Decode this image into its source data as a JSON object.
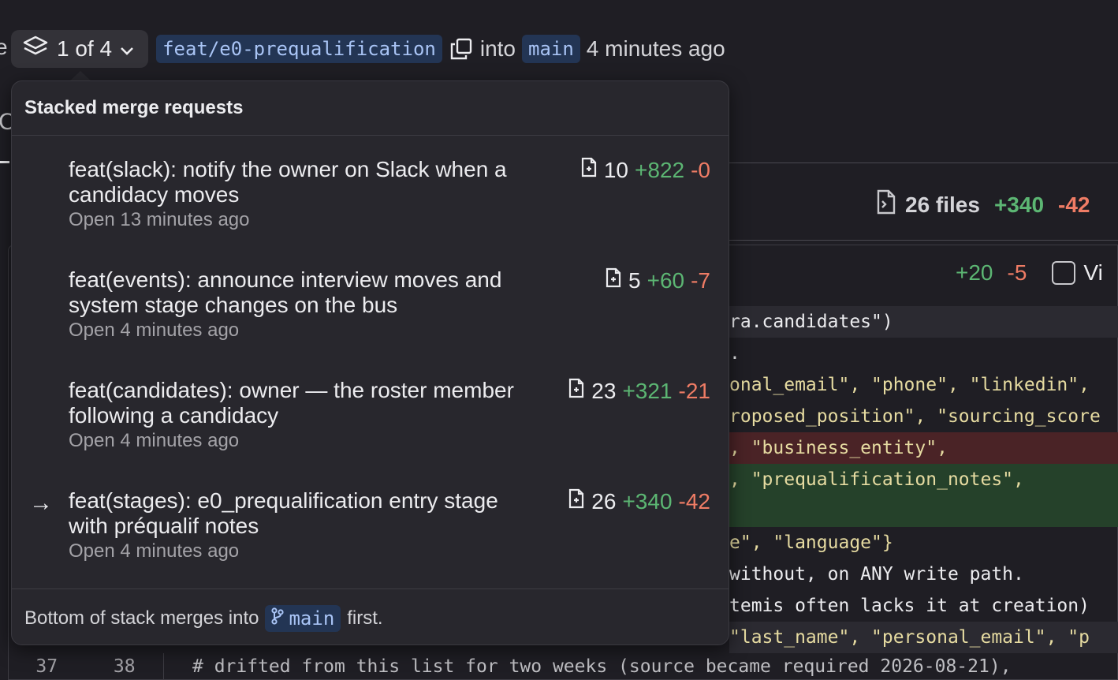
{
  "header": {
    "stack_label": "1 of 4",
    "source_branch": "feat/e0-prequalification",
    "into_text": "into",
    "target_branch": "main",
    "time": "4 minutes ago"
  },
  "background": {
    "edge_char": "e",
    "title_char": "C",
    "files_label": "26 files",
    "files_added": "+340",
    "files_removed": "-42",
    "file_added": "+20",
    "file_removed": "-5",
    "viewed_label": "Vi",
    "code_lines": [
      "ra.candidates\")",
      ".",
      "onal_email\", \"phone\", \"linkedin\",",
      "roposed_position\", \"sourcing_score",
      ", \"business_entity\",",
      ", \"prequalification_notes\",",
      "",
      "e\", \"language\"}",
      "without, on ANY write path.",
      "temis often lacks it at creation)",
      "\"last_name\", \"personal_email\", \"p"
    ],
    "bottom_line": {
      "old_num": "37",
      "new_num": "38",
      "code": "# drifted from this list for two weeks (source became required 2026-08-21),"
    }
  },
  "popover": {
    "title": "Stacked merge requests",
    "items": [
      {
        "title_line1": "feat(slack): notify the owner on Slack when a",
        "title_line2": "candidacy moves",
        "status": "Open 13 minutes ago",
        "files": "10",
        "added": "+822",
        "removed": "-0",
        "current": false
      },
      {
        "title_line1": "feat(events): announce interview moves and",
        "title_line2": "system stage changes on the bus",
        "status": "Open 4 minutes ago",
        "files": "5",
        "added": "+60",
        "removed": "-7",
        "current": false
      },
      {
        "title_line1": "feat(candidates): owner — the roster member",
        "title_line2": "following a candidacy",
        "status": "Open 4 minutes ago",
        "files": "23",
        "added": "+321",
        "removed": "-21",
        "current": false
      },
      {
        "title_line1": "feat(stages): e0_prequalification entry stage",
        "title_line2": "with préqualif notes",
        "status": "Open 4 minutes ago",
        "files": "26",
        "added": "+340",
        "removed": "-42",
        "current": true,
        "current_marker": "→"
      }
    ],
    "footer": {
      "prefix": "Bottom of stack merges into",
      "branch": "main",
      "suffix": "first."
    }
  },
  "icons": {
    "stack": "layers-icon",
    "chevron": "chevron-down-icon",
    "copy": "copy-icon",
    "file": "file-diff-icon",
    "branch": "branch-icon"
  }
}
